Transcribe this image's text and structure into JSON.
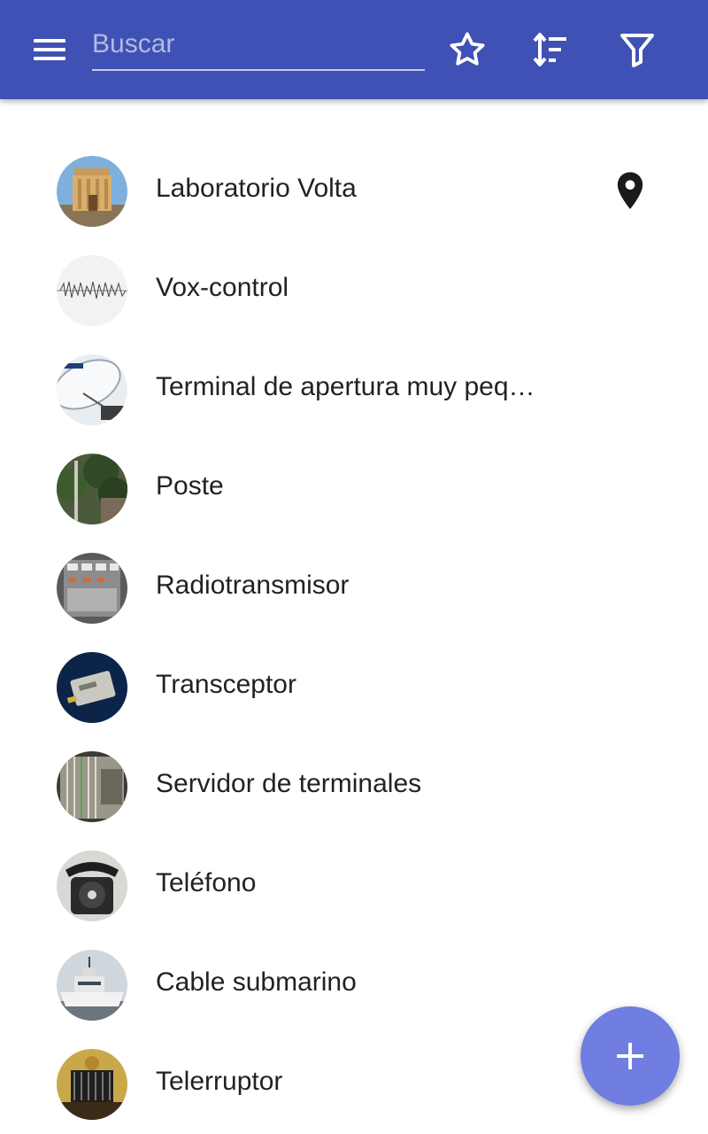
{
  "appbar": {
    "search": {
      "placeholder": "Buscar",
      "value": ""
    },
    "icons": {
      "menu": "menu-icon",
      "favorites": "star-outline-icon",
      "sort": "sort-icon",
      "filter": "filter-icon"
    },
    "color": "#3f51b5"
  },
  "list": {
    "items": [
      {
        "label": "Laboratorio Volta",
        "avatar": "building-photo",
        "trailing_icon": "location-pin-icon"
      },
      {
        "label": "Vox-control",
        "avatar": "waveform-photo"
      },
      {
        "label": "Terminal de apertura muy peq…",
        "avatar": "satellite-dish-photo"
      },
      {
        "label": "Poste",
        "avatar": "utility-pole-photo"
      },
      {
        "label": "Radiotransmisor",
        "avatar": "radio-equipment-photo"
      },
      {
        "label": "Transceptor",
        "avatar": "transceiver-module-photo"
      },
      {
        "label": "Servidor de terminales",
        "avatar": "terminal-server-photo"
      },
      {
        "label": "Teléfono",
        "avatar": "rotary-phone-photo"
      },
      {
        "label": "Cable submarino",
        "avatar": "cable-ship-photo"
      },
      {
        "label": "Telerruptor",
        "avatar": "relay-device-photo"
      }
    ]
  },
  "fab": {
    "icon": "plus-icon",
    "color": "#6f7ee0"
  }
}
